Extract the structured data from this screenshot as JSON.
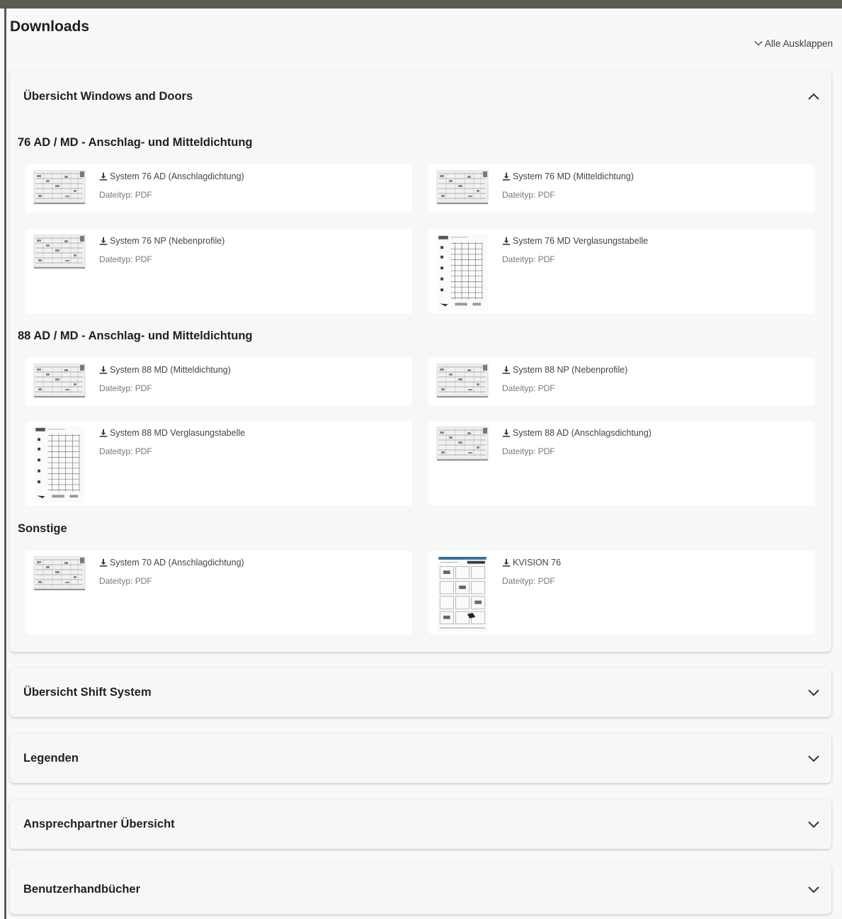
{
  "page": {
    "title": "Downloads",
    "expand_all_label": "Alle Ausklappen"
  },
  "panels": [
    {
      "title": "Übersicht Windows and Doors",
      "expanded": true,
      "groups": [
        {
          "title": "76 AD / MD - Anschlag- und Mitteldichtung",
          "items": [
            {
              "label": "System 76 AD (Anschlagdichtung)",
              "meta": "Dateityp: PDF"
            },
            {
              "label": "System 76 MD (Mitteldichtung)",
              "meta": "Dateityp: PDF"
            },
            {
              "label": "System 76 NP (Nebenprofile)",
              "meta": "Dateityp: PDF"
            },
            {
              "label": "System 76 MD Verglasungstabelle",
              "meta": "Dateityp: PDF"
            }
          ]
        },
        {
          "title": "88 AD / MD - Anschlag- und Mitteldichtung",
          "items": [
            {
              "label": "System 88 MD (Mitteldichtung)",
              "meta": "Dateityp: PDF"
            },
            {
              "label": "System 88 NP (Nebenprofile)",
              "meta": "Dateityp: PDF"
            },
            {
              "label": "System 88 MD Verglasungstabelle",
              "meta": "Dateityp: PDF"
            },
            {
              "label": "System 88 AD (Anschlagsdichtung)",
              "meta": "Dateityp: PDF"
            }
          ]
        },
        {
          "title": "Sonstige",
          "items": [
            {
              "label": "System 70 AD (Anschlagdichtung)",
              "meta": "Dateityp: PDF"
            },
            {
              "label": "KVISION 76",
              "meta": "Dateityp: PDF"
            }
          ]
        }
      ]
    },
    {
      "title": "Übersicht Shift System",
      "expanded": false
    },
    {
      "title": "Legenden",
      "expanded": false
    },
    {
      "title": "Ansprechpartner Übersicht",
      "expanded": false
    },
    {
      "title": "Benutzerhandbücher",
      "expanded": false
    }
  ],
  "icons": {
    "download": "download-icon",
    "chevron_up": "chevron-up-icon",
    "chevron_down": "chevron-down-icon",
    "expand_all": "chevron-down-icon"
  },
  "colors": {
    "page_background": "#f8f8f8",
    "card_background": "#ffffff",
    "top_bar": "#5b5b52",
    "text": "#1f1f1f",
    "meta_text": "#777777"
  }
}
